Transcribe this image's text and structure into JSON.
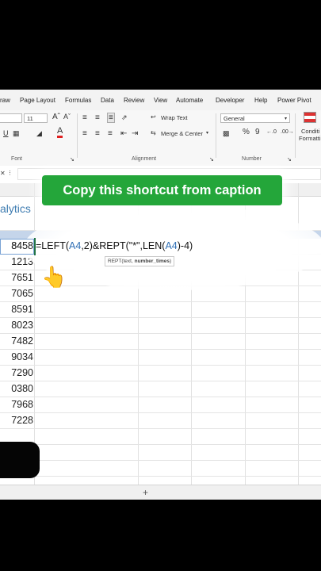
{
  "menu": {
    "items": [
      "raw",
      "Page Layout",
      "Formulas",
      "Data",
      "Review",
      "View",
      "Automate",
      "Developer",
      "Help",
      "Power Pivot"
    ]
  },
  "ribbon": {
    "font_size": "11",
    "wrap_text": "Wrap Text",
    "merge_center": "Merge & Center",
    "number_format": "General",
    "cond_format": "Conditi",
    "cond_format_2": "Formatti",
    "group_font": "Font",
    "group_alignment": "Alignment",
    "group_number": "Number",
    "percent": "%",
    "comma": "9",
    "font_color_letter": "A"
  },
  "sheet": {
    "heading": "alytics",
    "values": [
      "8458",
      "1213",
      "7651",
      "7065",
      "8591",
      "8023",
      "7482",
      "9034",
      "7290",
      "0380",
      "7968",
      "7228"
    ],
    "formula": {
      "p1": "=LEFT(",
      "r1": "A4",
      "p2": ",2)&REPT(\"*\",LEN(",
      "r2": "A4",
      "p3": ")-4)"
    },
    "tooltip_fn": "REPT(text, ",
    "tooltip_arg": "number_times",
    "tooltip_end": ")",
    "add_sheet": "+"
  },
  "overlay": {
    "caption_button": "Copy this shortcut from caption",
    "pointer_emoji": "👆"
  },
  "colors": {
    "caption_green": "#24a63a",
    "reference_blue": "#2f6fb5",
    "selected_row_header": "#c5d5ea"
  }
}
